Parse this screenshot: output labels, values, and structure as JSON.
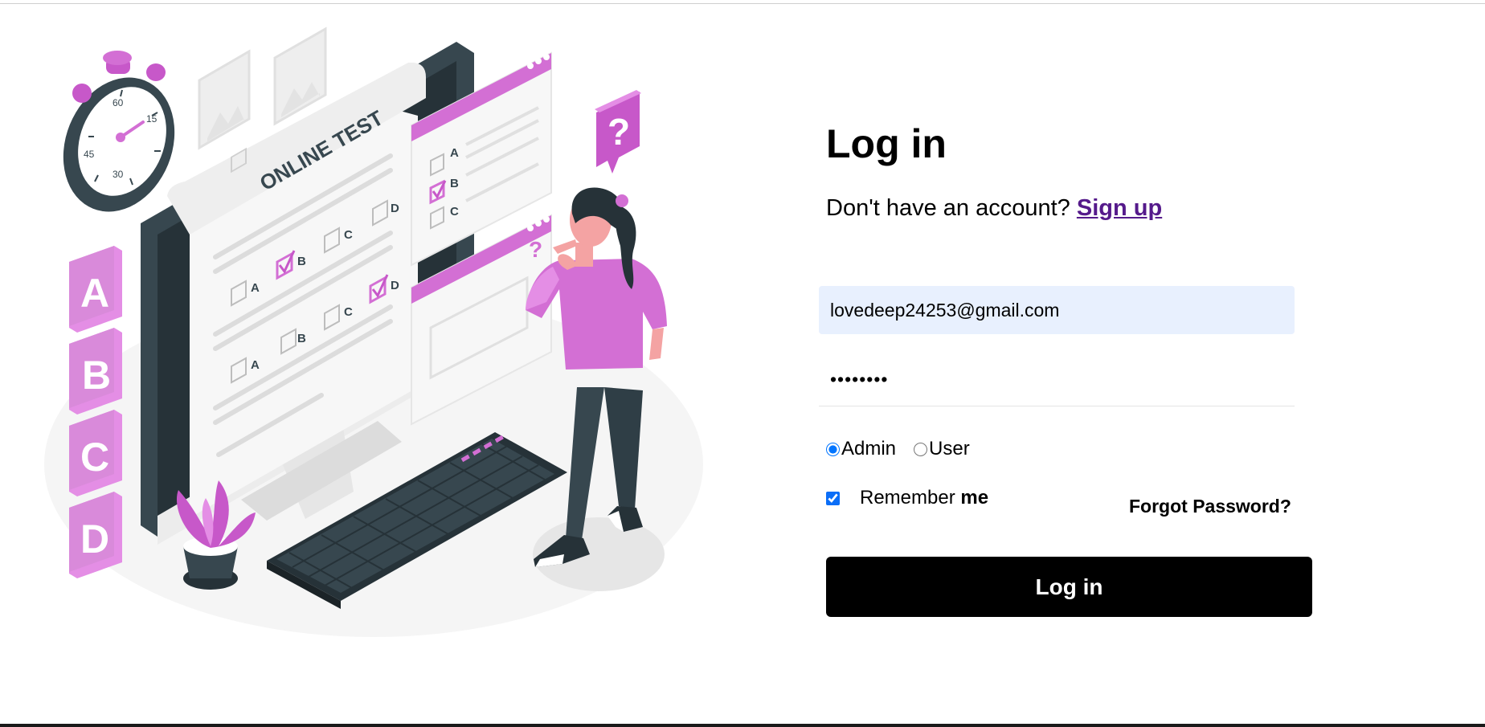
{
  "login": {
    "title": "Log in",
    "signup_prompt": "Don't have an account?",
    "signup_link": "Sign up",
    "email_value": "lovedeep24253@gmail.com",
    "password_value": "password",
    "roles": [
      {
        "label": "Admin",
        "selected": true
      },
      {
        "label": "User",
        "selected": false
      }
    ],
    "remember_label_prefix": "Remember",
    "remember_label_bold": "me",
    "remember_checked": true,
    "forgot_password": "Forgot Password?",
    "submit_label": "Log in"
  },
  "illustration": {
    "test_heading": "ONLINE TEST",
    "answer_options": [
      "A",
      "B",
      "C",
      "D"
    ],
    "stopwatch_marks": [
      "60",
      "15",
      "30",
      "45"
    ],
    "question_mark": "?"
  },
  "colors": {
    "accent": "#d36fd4",
    "accent_dark": "#b34db5",
    "slate": "#37474f",
    "button": "#000000",
    "input_fill": "#e8f0fe",
    "link": "#551a8b"
  }
}
